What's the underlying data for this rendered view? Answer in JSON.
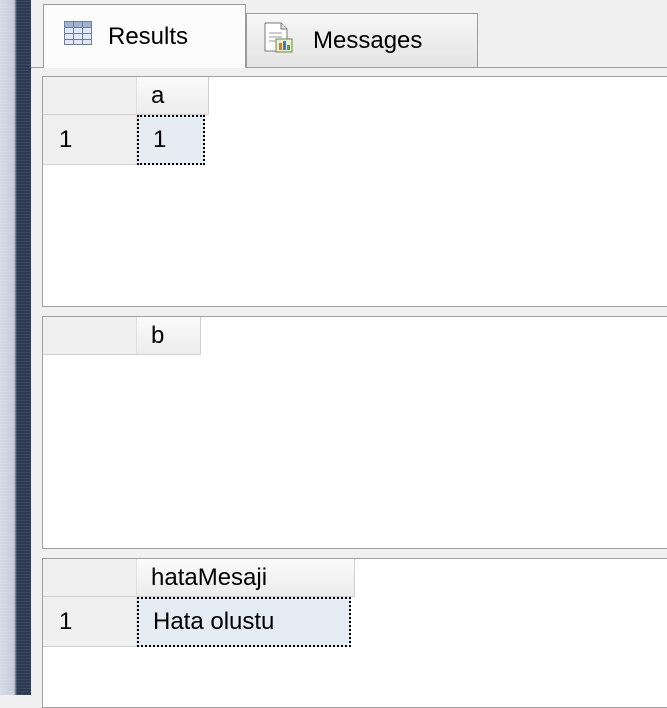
{
  "tabs": [
    {
      "label": "Results",
      "icon": "grid-icon",
      "active": true
    },
    {
      "label": "Messages",
      "icon": "messages-icon",
      "active": false
    }
  ],
  "grids": [
    {
      "columns": [
        "a"
      ],
      "rows": [
        {
          "row_number": "1",
          "values": [
            "1"
          ]
        }
      ]
    },
    {
      "columns": [
        "b"
      ],
      "rows": []
    },
    {
      "columns": [
        "hataMesaji"
      ],
      "rows": [
        {
          "row_number": "1",
          "values": [
            "Hata olustu"
          ]
        }
      ]
    }
  ],
  "colors": {
    "selected_cell": "#e6ecf4",
    "header_bg": "#f0f0f0",
    "panel_border": "#a0a0a0",
    "side_bar": "#2c3a54"
  }
}
